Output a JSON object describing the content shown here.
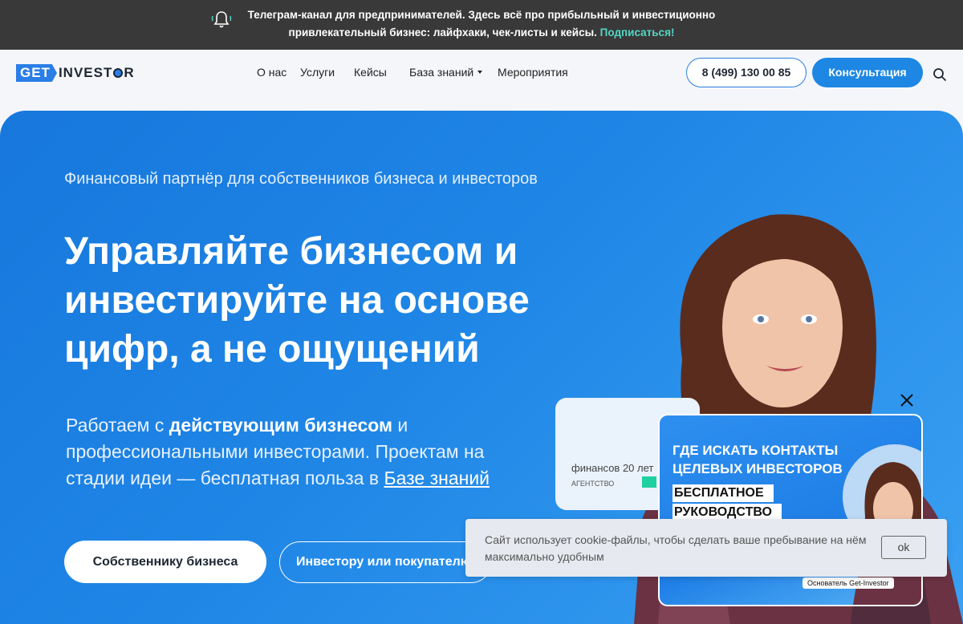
{
  "topbar": {
    "message": "Телеграм-канал для предпринимателей. Здесь всё про прибыльный и инвестиционно привлекательный бизнес: лайфхаки, чек-листы и кейсы.",
    "subscribe": "Подписаться!"
  },
  "header": {
    "logo_get": "GET",
    "logo_inv_a": "INVEST",
    "logo_inv_b": "R",
    "nav": {
      "about": "О нас",
      "services": "Услуги",
      "cases": "Кейсы",
      "knowledge": "База знаний",
      "events": "Мероприятия"
    },
    "phone": "8 (499) 130 00 85",
    "consult": "Консультация"
  },
  "hero": {
    "subtitle": "Финансовый партнёр для собственников бизнеса и инвесторов",
    "title_line1": "Управляйте бизнесом и",
    "title_line2": "инвестируйте на основе",
    "title_line3": "цифр, а не ощущений",
    "desc_pre": "Работаем с ",
    "desc_bold": "действующим бизнесом",
    "desc_mid": " и профессиональными инвесторами. Проектам на стадии идеи — бесплатная польза в ",
    "desc_link": "Базе знаний",
    "btn_owner": "Собственнику бизнеса",
    "btn_investor": "Инвестору или покупателю"
  },
  "back_card": {
    "text": "финансов 20 лет",
    "small": "АГЕНТСТВО"
  },
  "promo": {
    "title": "ГДЕ ИСКАТЬ КОНТАКТЫ ЦЕЛЕВЫХ ИНВЕСТОРОВ",
    "tag1": "БЕСПЛАТНОЕ",
    "tag2": "РУКОВОДСТВО",
    "caption": "Основатель Get-Investor"
  },
  "cookie": {
    "text": "Сайт использует cookie-файлы, чтобы сделать ваше пребывание на нём максимально удобным",
    "ok": "ok"
  },
  "colors": {
    "accent": "#1d87e3",
    "topbar_bg": "#393939",
    "subscribe": "#54d6c3"
  }
}
